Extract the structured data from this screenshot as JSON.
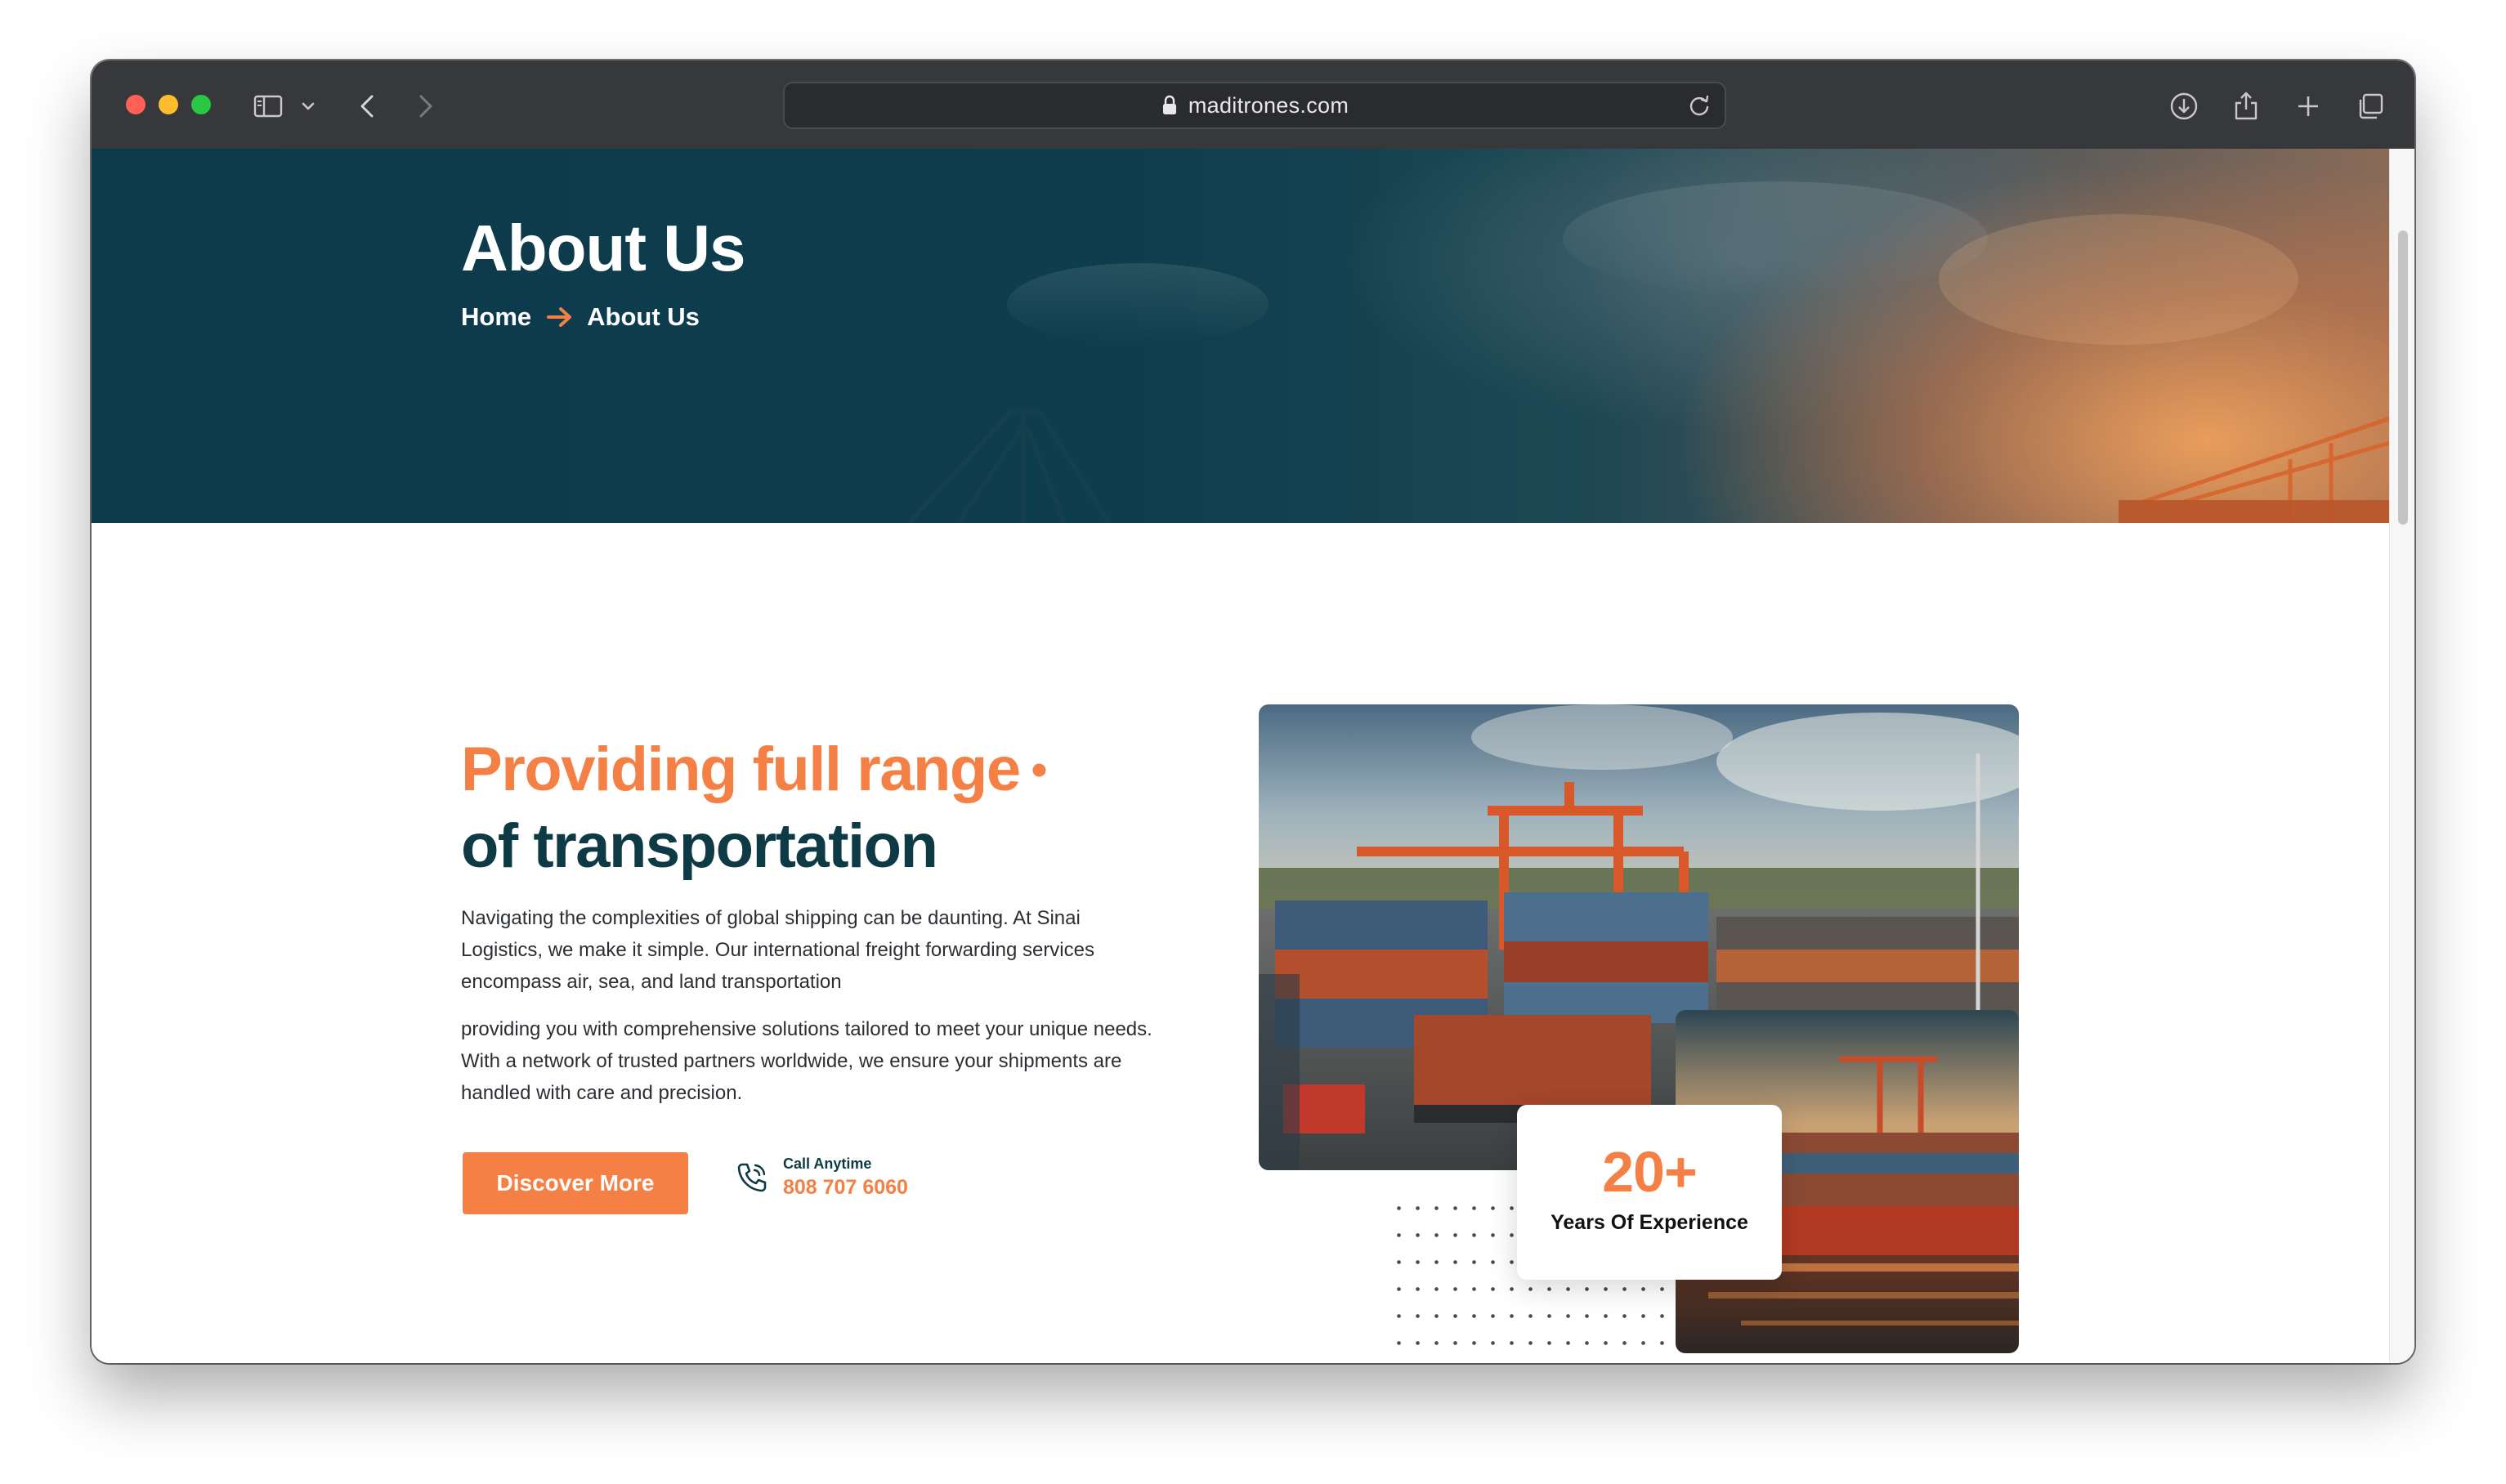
{
  "browser": {
    "url": "maditrones.com",
    "icons": [
      "sidebar-icon",
      "chevron-down-icon",
      "back-icon",
      "forward-icon",
      "lock-icon",
      "reload-icon",
      "download-icon",
      "share-icon",
      "plus-icon",
      "tabs-icon"
    ]
  },
  "hero": {
    "title": "About Us",
    "breadcrumb": {
      "home": "Home",
      "current": "About Us"
    }
  },
  "about": {
    "heading_line1": "Providing full range",
    "heading_dot": "•",
    "heading_line2": "of transportation",
    "paragraph1": "Navigating the complexities of global shipping can be daunting. At Sinai Logistics, we make it simple. Our international freight forwarding services encompass air, sea, and land transportation",
    "paragraph2": "providing you with comprehensive solutions tailored to meet your unique needs. With a network of trusted partners worldwide, we ensure your shipments are handled with care and precision.",
    "cta_label": "Discover More",
    "call_label": "Call Anytime",
    "call_number": "808 707 6060"
  },
  "experience": {
    "value": "20+",
    "label": "Years Of Experience"
  },
  "colors": {
    "accent": "#f58046",
    "dark": "#0e3a46",
    "hero_bg": "#0c3a4a"
  }
}
